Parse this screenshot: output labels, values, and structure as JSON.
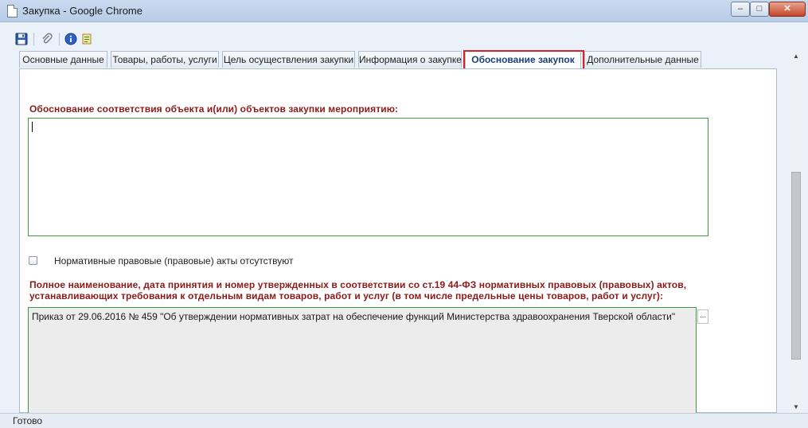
{
  "window": {
    "title": "Закупка - Google Chrome",
    "min_label": "–",
    "max_label": "□",
    "close_label": "✕"
  },
  "toolbar": {
    "icons": [
      "save-icon",
      "paperclip-icon",
      "info-icon",
      "document-icon"
    ]
  },
  "tabs": [
    {
      "label": "Основные данные"
    },
    {
      "label": "Товары, работы, услуги"
    },
    {
      "label": "Цель осуществления закупки"
    },
    {
      "label": "Информация о закупке"
    },
    {
      "label": "Обоснование закупок",
      "active": true
    },
    {
      "label": "Дополнительные данные"
    }
  ],
  "form": {
    "heading1": "Обоснование соответствия объекта и(или) объектов закупки мероприятию:",
    "textarea1_value": "",
    "checkbox_label": "Нормативные правовые (правовые) акты отсутствуют",
    "heading2_line1": "Полное наименование, дата принятия и номер утвержденных в соответствии со ст.19 44-ФЗ нормативных правовых (правовых) актов,",
    "heading2_line2": "устанавливающих требования к отдельным видам товаров, работ и услуг (в том числе предельные цены товаров, работ и услуг):",
    "textarea2_value": "Приказ от 29.06.2016 № 459 \"Об утверждении нормативных затрат на обеспечение функций Министерства здравоохранения Тверской области\"",
    "ellipsis_label": "..."
  },
  "status": {
    "text": "Готово"
  },
  "colors": {
    "heading": "#8b1a1a",
    "field_border": "#3c9b3c",
    "highlight": "#d2232a",
    "active_tab_text": "#1a3f7a"
  }
}
